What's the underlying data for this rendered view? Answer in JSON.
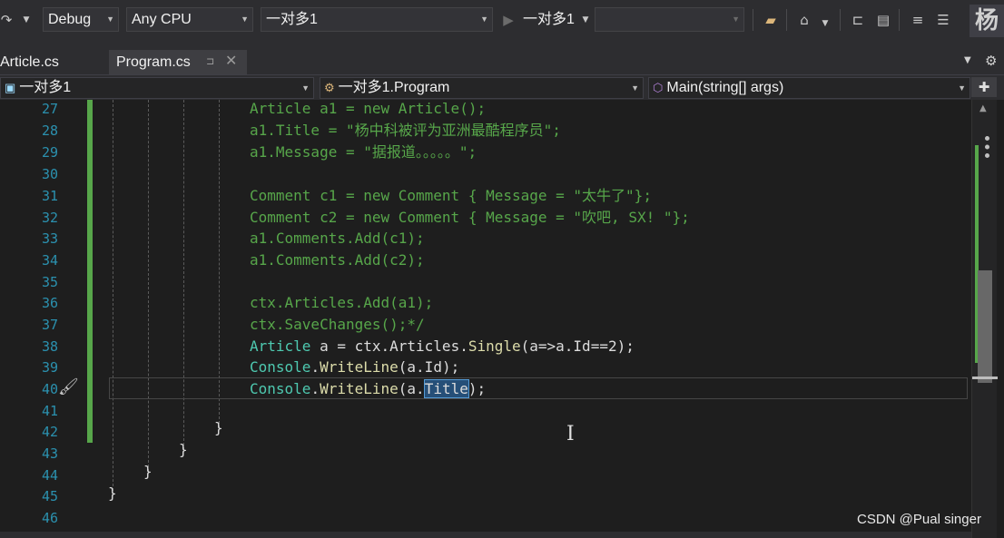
{
  "toolbar": {
    "config": "Debug",
    "platform": "Any CPU",
    "startup_project": "一对多1",
    "run_target": "一对多1",
    "icons": [
      "redo-icon",
      "folder-icon",
      "home-icon",
      "format-icon",
      "indent-icon",
      "comment-icon",
      "uncomment-icon"
    ],
    "avatar_text": "杨"
  },
  "tabs": [
    {
      "label": "Article.cs",
      "active": false
    },
    {
      "label": "Program.cs",
      "active": true
    }
  ],
  "navbar": {
    "project": "一对多1",
    "type": "一对多1.Program",
    "member": "Main(string[] args)"
  },
  "editor": {
    "line_numbers": [
      "27",
      "28",
      "29",
      "30",
      "31",
      "32",
      "33",
      "34",
      "35",
      "36",
      "37",
      "38",
      "39",
      "40",
      "41",
      "42",
      "43",
      "44",
      "45",
      "46"
    ],
    "selected_word": "Title",
    "lines": {
      "l27": "Article a1 = new Article();",
      "l28": "a1.Title = \"杨中科被评为亚洲最酷程序员\";",
      "l29": "a1.Message = \"据报道。。。。。\";",
      "l31": "Comment c1 = new Comment { Message = \"太牛了\"};",
      "l32": "Comment c2 = new Comment { Message = \"吹吧, SX! \"};",
      "l33": "a1.Comments.Add(c1);",
      "l34": "a1.Comments.Add(c2);",
      "l36": "ctx.Articles.Add(a1);",
      "l37": "ctx.SaveChanges();*/"
    },
    "code": {
      "l38_type": "Article",
      "l38_rest_a": " a = ctx.Articles.",
      "l38_method": "Single",
      "l38_rest_b": "(a=>a.Id==2);",
      "l39_type": "Console",
      "l39_dot": ".",
      "l39_method": "WriteLine",
      "l39_rest": "(a.Id);",
      "l40_type": "Console",
      "l40_dot": ".",
      "l40_method": "WriteLine",
      "l40_pre": "(a.",
      "l40_post": ");"
    },
    "braces": [
      "}",
      "}",
      "}",
      "}"
    ]
  },
  "watermark": "CSDN @Pual singer",
  "colors": {
    "background": "#1e1e1e",
    "comment": "#57a64a",
    "type": "#4ec9b0",
    "method": "#dcdcaa",
    "line_number": "#2b91af",
    "selection": "#264f78"
  }
}
